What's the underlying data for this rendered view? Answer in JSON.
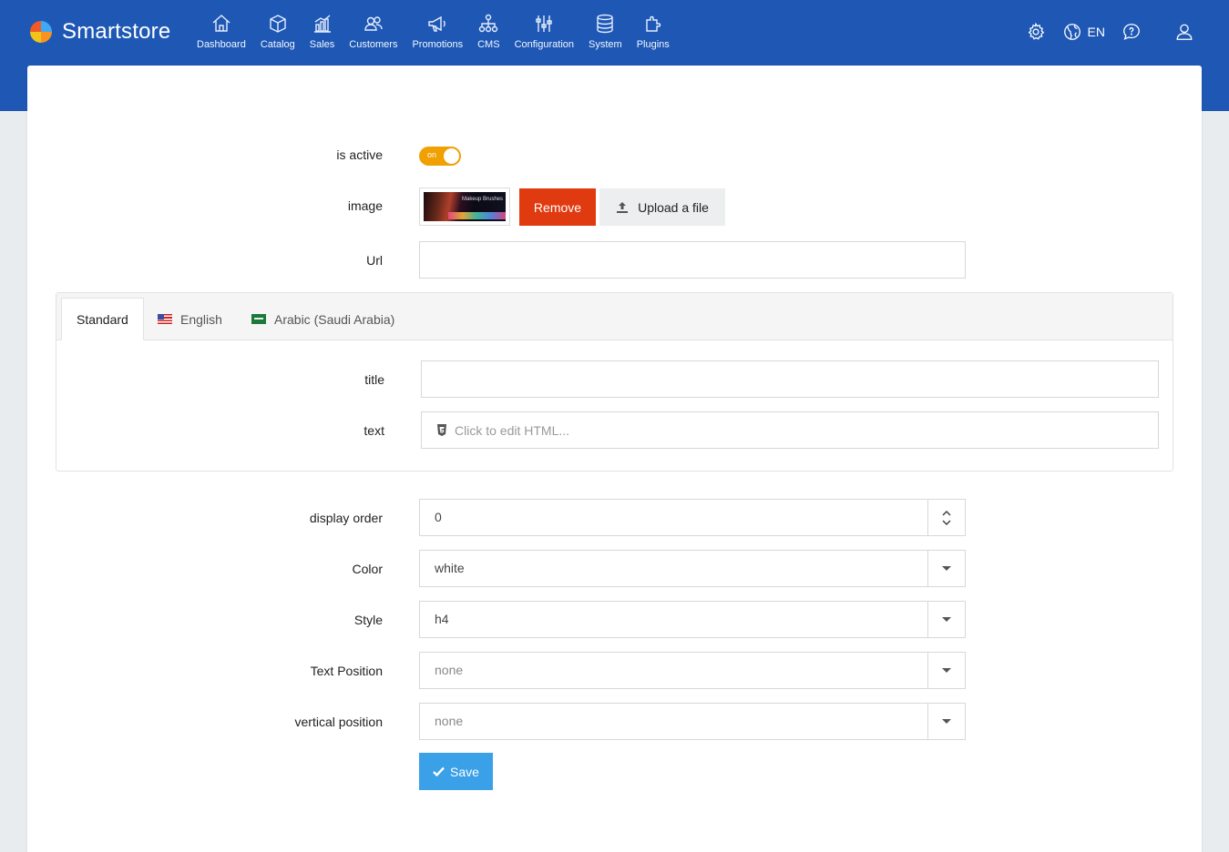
{
  "app": {
    "brand": "Smartstore"
  },
  "nav": [
    {
      "label": "Dashboard",
      "icon": "home-icon"
    },
    {
      "label": "Catalog",
      "icon": "box-icon"
    },
    {
      "label": "Sales",
      "icon": "chart-icon"
    },
    {
      "label": "Customers",
      "icon": "users-icon"
    },
    {
      "label": "Promotions",
      "icon": "megaphone-icon"
    },
    {
      "label": "CMS",
      "icon": "sitemap-icon"
    },
    {
      "label": "Configuration",
      "icon": "sliders-icon"
    },
    {
      "label": "System",
      "icon": "database-icon"
    },
    {
      "label": "Plugins",
      "icon": "puzzle-icon"
    }
  ],
  "top_right": {
    "language": "EN"
  },
  "form": {
    "is_active": {
      "label": "is active",
      "toggle_text": "on",
      "value": true
    },
    "image": {
      "label": "image",
      "thumb_caption": "Makeup Brushes",
      "remove_label": "Remove",
      "upload_label": "Upload a file"
    },
    "url": {
      "label": "Url",
      "value": ""
    },
    "tabs": [
      {
        "label": "Standard",
        "active": true
      },
      {
        "label": "English",
        "flag": "us"
      },
      {
        "label": "Arabic (Saudi Arabia)",
        "flag": "sa"
      }
    ],
    "title": {
      "label": "title",
      "value": ""
    },
    "text": {
      "label": "text",
      "placeholder": "Click to edit HTML..."
    },
    "display_order": {
      "label": "display order",
      "value": "0"
    },
    "color": {
      "label": "Color",
      "value": "white"
    },
    "style": {
      "label": "Style",
      "value": "h4"
    },
    "text_position": {
      "label": "Text Position",
      "value": "none"
    },
    "vertical_position": {
      "label": "vertical position",
      "value": "none"
    },
    "save_label": "Save"
  },
  "colors": {
    "header": "#1e58b4",
    "toggle": "#f0a000",
    "remove": "#e03a10",
    "save": "#3aa0e8"
  }
}
